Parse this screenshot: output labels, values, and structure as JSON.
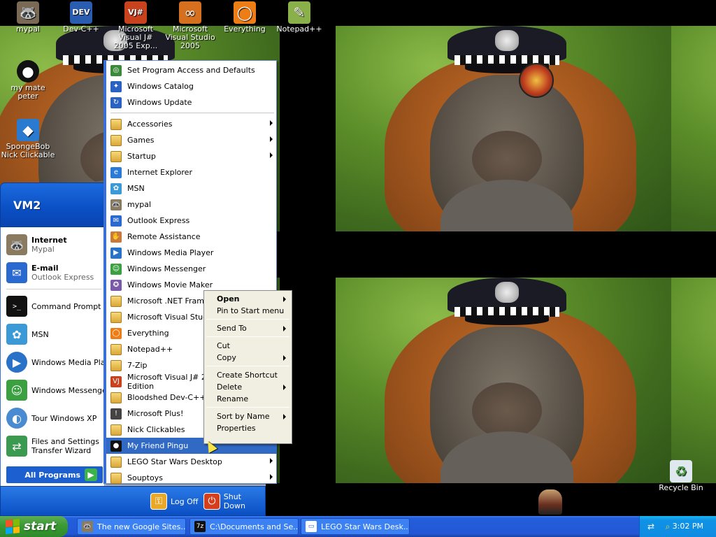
{
  "desktop": {
    "icons": [
      {
        "label": "mypal",
        "glyph": "🦝",
        "icon": "raccoon-icon",
        "color": "#7a6a55"
      },
      {
        "label": "Dev-C++",
        "glyph": "DEV",
        "icon": "devcpp-icon",
        "color": "#2a5db0"
      },
      {
        "label": "Microsoft Visual J# 2005 Exp...",
        "glyph": "VJ#",
        "icon": "vjsharp-icon",
        "color": "#c8421e"
      },
      {
        "label": "Microsoft Visual Studio 2005",
        "glyph": "∞",
        "icon": "visual-studio-icon",
        "color": "#d4701e"
      },
      {
        "label": "Everything",
        "glyph": "◯",
        "icon": "everything-icon",
        "color": "#ef7d16"
      },
      {
        "label": "Notepad++",
        "glyph": "✎",
        "icon": "notepadpp-icon",
        "color": "#8ab04a"
      },
      {
        "label": "my mate peter",
        "glyph": "●",
        "icon": "pingu-icon",
        "color": "#111111"
      },
      {
        "label": "SpongeBob Nick Clickable",
        "glyph": "◆",
        "icon": "spongebob-icon",
        "color": "#2a7ad0"
      },
      {
        "label": "Recycle Bin",
        "glyph": "♻",
        "icon": "recycle-bin-icon",
        "color": "#4aa040"
      }
    ]
  },
  "start_menu": {
    "user": "VM2",
    "pinned": [
      {
        "title": "Internet",
        "subtitle": "Mypal",
        "icon": "raccoon-icon",
        "glyph": "🦝",
        "color": "#8a7a60"
      },
      {
        "title": "E-mail",
        "subtitle": "Outlook Express",
        "icon": "outlook-icon",
        "glyph": "✉",
        "color": "#2a6ad0"
      }
    ],
    "recent": [
      {
        "title": "Command Prompt",
        "icon": "cmd-icon",
        "glyph": ">_",
        "color": "#111111"
      },
      {
        "title": "MSN",
        "icon": "msn-icon",
        "glyph": "✿",
        "color": "#3a9ad8"
      },
      {
        "title": "Windows Media Player",
        "icon": "media-player-icon",
        "glyph": "▶",
        "color": "#2a72c8"
      },
      {
        "title": "Windows Messenger",
        "icon": "messenger-icon",
        "glyph": "☺",
        "color": "#3aa040"
      },
      {
        "title": "Tour Windows XP",
        "icon": "tour-icon",
        "glyph": "◐",
        "color": "#4a8ad0"
      },
      {
        "title": "Files and Settings Transfer Wizard",
        "icon": "transfer-wizard-icon",
        "glyph": "⇄",
        "color": "#3a9a50"
      }
    ],
    "all_programs_label": "All Programs",
    "log_off_label": "Log Off",
    "shut_down_label": "Shut Down"
  },
  "programs_menu": {
    "items": [
      {
        "label": "Set Program Access and Defaults",
        "icon": "program-access-icon",
        "glyph": "◎",
        "color": "#3a8a3a"
      },
      {
        "label": "Windows Catalog",
        "icon": "windows-catalog-icon",
        "glyph": "✦",
        "color": "#2a62c4"
      },
      {
        "label": "Windows Update",
        "icon": "windows-update-icon",
        "glyph": "↻",
        "color": "#2a62c4"
      },
      {
        "label": "Accessories",
        "icon": "folder-icon",
        "folder": true,
        "submenu": true
      },
      {
        "label": "Games",
        "icon": "folder-icon",
        "folder": true,
        "submenu": true
      },
      {
        "label": "Startup",
        "icon": "folder-icon",
        "folder": true,
        "submenu": true
      },
      {
        "label": "Internet Explorer",
        "icon": "internet-explorer-icon",
        "glyph": "e",
        "color": "#2a7ad8"
      },
      {
        "label": "MSN",
        "icon": "msn-icon",
        "glyph": "✿",
        "color": "#3a9ad8"
      },
      {
        "label": "mypal",
        "icon": "raccoon-icon",
        "glyph": "🦝",
        "color": "#8a7a60"
      },
      {
        "label": "Outlook Express",
        "icon": "outlook-icon",
        "glyph": "✉",
        "color": "#2a6ad0"
      },
      {
        "label": "Remote Assistance",
        "icon": "remote-assistance-icon",
        "glyph": "✋",
        "color": "#c87a3a"
      },
      {
        "label": "Windows Media Player",
        "icon": "media-player-icon",
        "glyph": "▶",
        "color": "#2a72c8"
      },
      {
        "label": "Windows Messenger",
        "icon": "messenger-icon",
        "glyph": "☺",
        "color": "#3aa040"
      },
      {
        "label": "Windows Movie Maker",
        "icon": "movie-maker-icon",
        "glyph": "✪",
        "color": "#7a5aa8"
      },
      {
        "label": "Microsoft .NET Framework SDK v2.0",
        "icon": "folder-icon",
        "folder": true,
        "submenu": true
      },
      {
        "label": "Microsoft Visual Studio 2005",
        "icon": "folder-icon",
        "folder": true,
        "submenu": true
      },
      {
        "label": "Everything",
        "icon": "everything-icon",
        "glyph": "◯",
        "color": "#ef7d16"
      },
      {
        "label": "Notepad++",
        "icon": "folder-icon",
        "folder": true,
        "submenu": true
      },
      {
        "label": "7-Zip",
        "icon": "folder-icon",
        "folder": true,
        "submenu": true
      },
      {
        "label": "Microsoft Visual J# 2005 Express Edition",
        "icon": "vjsharp-icon",
        "glyph": "VJ",
        "color": "#c8421e"
      },
      {
        "label": "Bloodshed Dev-C++",
        "icon": "folder-icon",
        "folder": true,
        "submenu": true
      },
      {
        "label": "Microsoft Plus!",
        "icon": "microsoft-plus-icon",
        "glyph": "!",
        "color": "#444444"
      },
      {
        "label": "Nick Clickables",
        "icon": "folder-icon",
        "folder": true,
        "submenu": true
      },
      {
        "label": "My Friend Pingu",
        "icon": "pingu-icon",
        "glyph": "●",
        "color": "#111111",
        "highlighted": true
      },
      {
        "label": "LEGO Star Wars Desktop",
        "icon": "folder-icon",
        "folder": true,
        "submenu": true
      },
      {
        "label": "Souptoys",
        "icon": "folder-icon",
        "folder": true,
        "submenu": true
      }
    ]
  },
  "context_menu": {
    "items": [
      {
        "label": "Open",
        "bold": true,
        "submenu": true
      },
      {
        "label": "Pin to Start menu"
      },
      {
        "sep": true
      },
      {
        "label": "Send To",
        "submenu": true
      },
      {
        "sep": true
      },
      {
        "label": "Cut"
      },
      {
        "label": "Copy",
        "submenu": true
      },
      {
        "sep": true
      },
      {
        "label": "Create Shortcut"
      },
      {
        "label": "Delete",
        "submenu": true
      },
      {
        "label": "Rename"
      },
      {
        "sep": true
      },
      {
        "label": "Sort by Name",
        "submenu": true
      },
      {
        "label": "Properties"
      }
    ]
  },
  "taskbar": {
    "start_label": "start",
    "tasks": [
      {
        "label": "The new Google Sites...",
        "icon": "raccoon-icon",
        "glyph": "🦝",
        "color": "#8a7a60"
      },
      {
        "label": "C:\\Documents and Se...",
        "icon": "7zip-icon",
        "glyph": "7z",
        "color": "#111111"
      },
      {
        "label": "LEGO Star Wars Desk...",
        "icon": "window-icon",
        "glyph": "▭",
        "color": "#ffffff"
      }
    ],
    "clock": "3:02 PM",
    "colors": {
      "bar": "#245edb",
      "start": "#3a9a33",
      "tray": "#0f8ce2"
    }
  }
}
